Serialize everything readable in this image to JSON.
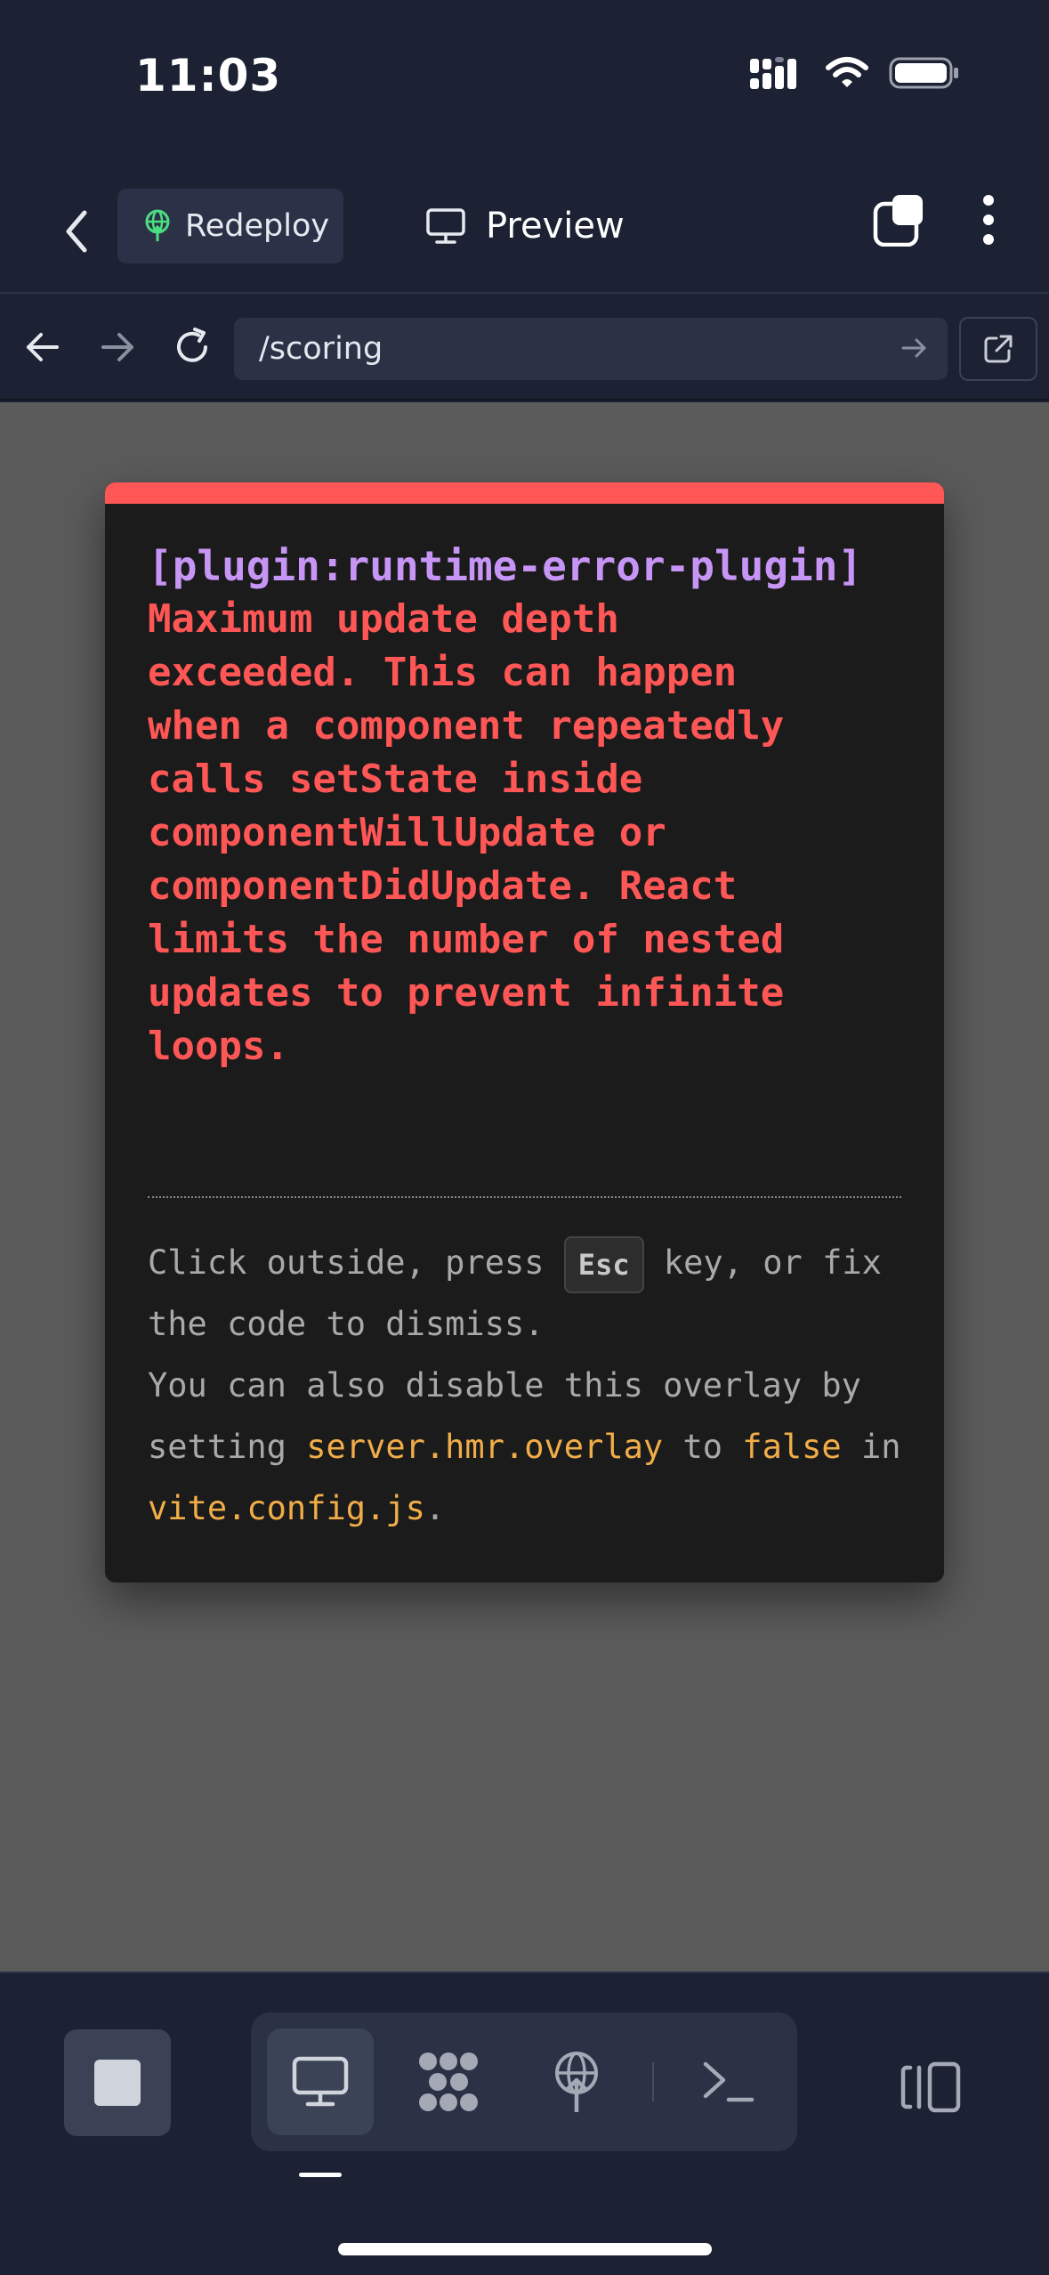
{
  "status_bar": {
    "time": "11:03"
  },
  "header": {
    "redeploy_label": "Redeploy",
    "preview_label": "Preview"
  },
  "url_bar": {
    "path": "/scoring"
  },
  "error_overlay": {
    "plugin": "[plugin:runtime-error-plugin]",
    "message": "Maximum update depth\nexceeded. This can happen\nwhen a component repeatedly\ncalls setState inside\ncomponentWillUpdate or\ncomponentDidUpdate. React\nlimits the number of nested\nupdates to prevent infinite\nloops.",
    "tip_part1": "Click outside, press ",
    "tip_key": "Esc",
    "tip_part2": " key, or fix the code to dismiss.",
    "tip_part3": "You can also disable this overlay by setting ",
    "tip_code1": "server.hmr.overlay",
    "tip_part4": " to ",
    "tip_code2": "false",
    "tip_part5": " in ",
    "tip_code3": "vite.config.js",
    "tip_part6": "."
  },
  "colors": {
    "error_red": "#ff5656",
    "plugin_purple": "#c795f5",
    "code_orange": "#f1ad48",
    "redeploy_icon_green": "#4ade80"
  },
  "icons": {
    "back": "chevron-left-icon",
    "redeploy": "deploy-globe-icon",
    "preview": "monitor-icon",
    "tabs": "tabs-icon",
    "more": "more-vertical-icon",
    "nav_back": "arrow-left-icon",
    "nav_forward": "arrow-right-icon",
    "reload": "reload-icon",
    "go": "arrow-right-icon",
    "open_external": "external-link-icon",
    "stop": "stop-icon",
    "preview_mode": "monitor-icon",
    "packages": "dots-grid-icon",
    "deploy": "deploy-globe-icon",
    "terminal": "terminal-icon",
    "panel": "side-panel-icon"
  }
}
